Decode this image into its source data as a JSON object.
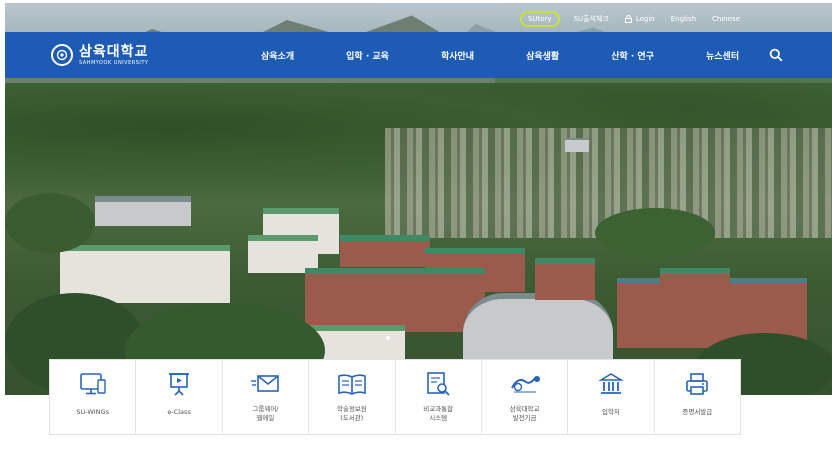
{
  "util_bar": {
    "items": [
      {
        "label": "SUtory",
        "highlight": true
      },
      {
        "label": "SU출석체크"
      },
      {
        "label": "Login",
        "icon": "lock-icon"
      },
      {
        "label": "English"
      },
      {
        "label": "Chinese"
      }
    ]
  },
  "nav": {
    "logo_ko": "삼육대학교",
    "logo_en": "SAHMYOOK UNIVERSITY",
    "menu": [
      "삼육소개",
      "입학 · 교육",
      "학사안내",
      "삼육생활",
      "산학 · 연구",
      "뉴스센터"
    ],
    "search_icon": "search-icon"
  },
  "quick_links": [
    {
      "label": "SU-WINGs",
      "icon": "monitor-icon"
    },
    {
      "label": "e-Class",
      "icon": "presentation-icon"
    },
    {
      "label": "그룹웨어/\n웹메일",
      "icon": "mail-icon"
    },
    {
      "label": "학술정보원\n(도서관)",
      "icon": "book-icon"
    },
    {
      "label": "비교과통합\n시스템",
      "icon": "document-search-icon"
    },
    {
      "label": "삼육대학교\n발전기금",
      "icon": "fund-logo-icon"
    },
    {
      "label": "입학처",
      "icon": "building-icon"
    },
    {
      "label": "증명서발급",
      "icon": "printer-icon"
    }
  ],
  "colors": {
    "nav": "#1d5bb5",
    "highlight": "#c8e03a",
    "icon": "#2a63b8"
  }
}
